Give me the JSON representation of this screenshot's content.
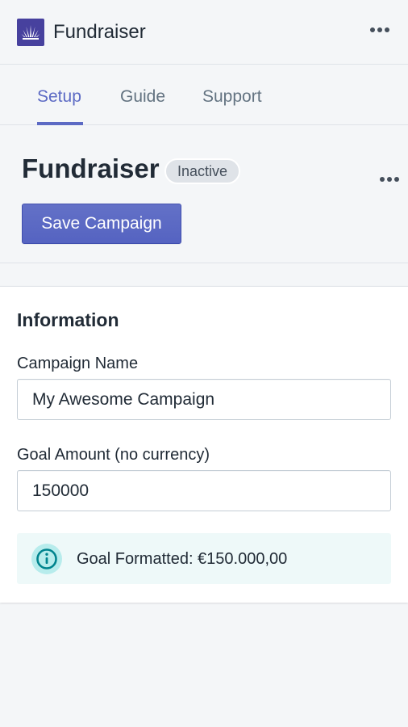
{
  "app": {
    "name": "Fundraiser",
    "logo_icon": "fan-logo-icon",
    "accent_color": "#5c6ac4",
    "logo_color": "#47419e"
  },
  "tabs": [
    {
      "label": "Setup",
      "active": true
    },
    {
      "label": "Guide",
      "active": false
    },
    {
      "label": "Support",
      "active": false
    }
  ],
  "page": {
    "title": "Fundraiser",
    "status_badge": "Inactive",
    "save_button": "Save Campaign",
    "more_actions_icon": "ellipsis-icon"
  },
  "information": {
    "heading": "Information",
    "campaign_name": {
      "label": "Campaign Name",
      "value": "My Awesome Campaign"
    },
    "goal_amount": {
      "label": "Goal Amount (no currency)",
      "value": "150000"
    },
    "goal_info": {
      "icon": "info-icon",
      "text": "Goal Formatted: €150.000,00",
      "banner_color": "#eef9f9",
      "icon_color": "#47c1bf"
    }
  }
}
